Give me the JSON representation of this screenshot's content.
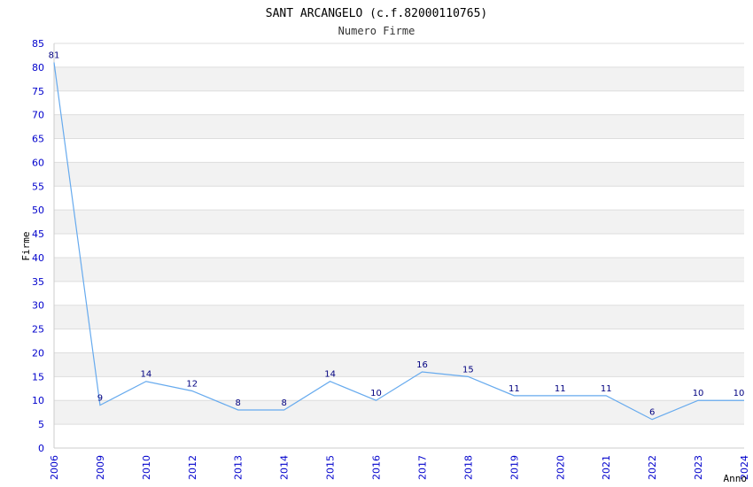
{
  "chart_data": {
    "type": "line",
    "title": "SANT ARCANGELO (c.f.82000110765)",
    "subtitle": "Numero Firme",
    "xlabel": "Anno",
    "ylabel": "Firme",
    "categories": [
      "2006",
      "2009",
      "2010",
      "2012",
      "2013",
      "2014",
      "2015",
      "2016",
      "2017",
      "2018",
      "2019",
      "2020",
      "2021",
      "2022",
      "2023",
      "2024"
    ],
    "series": [
      {
        "values": [
          81,
          9,
          14,
          12,
          8,
          8,
          14,
          10,
          16,
          15,
          11,
          11,
          11,
          6,
          10,
          10
        ]
      }
    ],
    "ylim": [
      0,
      85
    ],
    "ytick_step": 5,
    "grid": true,
    "band_color": "#f2f2f2",
    "grid_color": "#dddddd",
    "line_color": "#66aaee",
    "tick_color": "#0000cc",
    "label_color": "#000080"
  }
}
